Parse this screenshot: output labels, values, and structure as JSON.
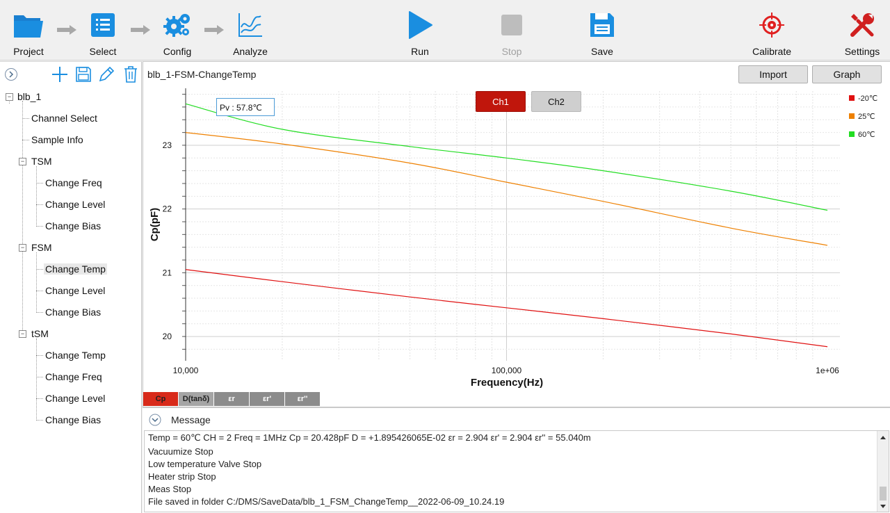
{
  "toolbar": {
    "project": "Project",
    "select": "Select",
    "config": "Config",
    "analyze": "Analyze",
    "run": "Run",
    "stop": "Stop",
    "save": "Save",
    "calibrate": "Calibrate",
    "settings": "Settings"
  },
  "tree": {
    "root": "blb_1",
    "channel_select": "Channel Select",
    "sample_info": "Sample Info",
    "tsm_upper": "TSM",
    "tsm_items": [
      "Change Freq",
      "Change Level",
      "Change Bias"
    ],
    "fsm": "FSM",
    "fsm_items": [
      "Change Temp",
      "Change Level",
      "Change Bias"
    ],
    "tsm_lower": "tSM",
    "tsm_lower_items": [
      "Change Temp",
      "Change Freq",
      "Change Level",
      "Change Bias"
    ]
  },
  "chart_panel": {
    "title": "blb_1-FSM-ChangeTemp",
    "import": "Import",
    "graph": "Graph",
    "ch1": "Ch1",
    "ch2": "Ch2",
    "pv_label": "Pv :  57.8℃",
    "tabs": [
      "Cp",
      "D(tanδ)",
      "εr",
      "εr'",
      "εr''"
    ]
  },
  "chart_data": {
    "type": "line",
    "xlabel": "Frequency(Hz)",
    "ylabel": "Cp(pF)",
    "xscale": "log",
    "xlim": [
      10000,
      1000000
    ],
    "ylim": [
      19.75,
      23.85
    ],
    "xtick_labels": [
      "10,000",
      "100,000",
      "1e+06"
    ],
    "ytick_labels": [
      "20",
      "21",
      "22",
      "23"
    ],
    "legend_position": "top-right",
    "grid": true,
    "x": [
      10000,
      20000,
      50000,
      100000,
      200000,
      500000,
      1000000
    ],
    "series": [
      {
        "name": "-20℃",
        "color": "#e01010",
        "values": [
          21.05,
          20.86,
          20.62,
          20.45,
          20.28,
          20.04,
          19.84
        ]
      },
      {
        "name": "25℃",
        "color": "#ee8000",
        "values": [
          23.2,
          23.02,
          22.72,
          22.42,
          22.12,
          21.7,
          21.43
        ]
      },
      {
        "name": "60℃",
        "color": "#22dd22",
        "values": [
          23.65,
          23.25,
          22.98,
          22.8,
          22.6,
          22.28,
          21.98
        ]
      }
    ]
  },
  "message": {
    "title": "Message",
    "lines": [
      "Temp = 60℃    CH = 2    Freq = 1MHz    Cp = 20.428pF    D = +1.895426065E-02    εr = 2.904    εr' = 2.904    εr'' = 55.040m",
      "Vacuumize Stop",
      "Low temperature Valve Stop",
      "Heater strip Stop",
      "Meas Stop",
      "File saved in folder  C:/DMS/SaveData/blb_1_FSM_ChangeTemp__2022-06-09_10.24.19"
    ]
  },
  "colors": {
    "accent_blue": "#1a8ee0",
    "ch1_active": "#c0160c",
    "cp_tab_active": "#d82a1a"
  }
}
